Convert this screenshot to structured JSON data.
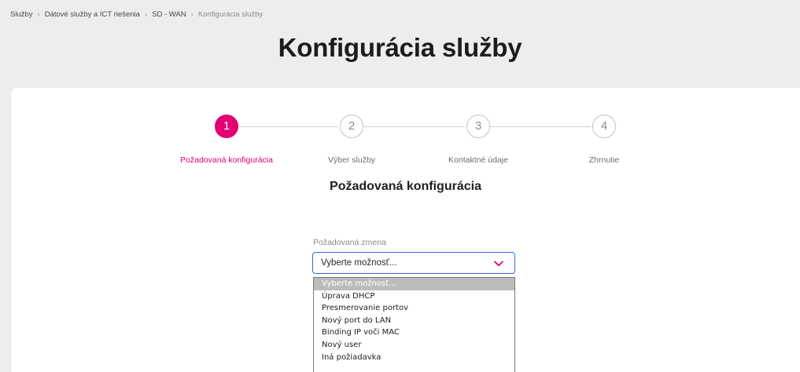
{
  "breadcrumb": {
    "items": [
      "Služby",
      "Dátové služby a ICT riešenia",
      "SD - WAN",
      "Konfigurácia služby"
    ],
    "separator": "›"
  },
  "page": {
    "title": "Konfigurácia služby"
  },
  "stepper": {
    "active_color": "#e20074",
    "steps": [
      {
        "number": "1",
        "label": "Požadovaná konfigurácia",
        "active": true
      },
      {
        "number": "2",
        "label": "Výber služby",
        "active": false
      },
      {
        "number": "3",
        "label": "Kontaktné údaje",
        "active": false
      },
      {
        "number": "4",
        "label": "Zhrnutie",
        "active": false
      }
    ]
  },
  "form": {
    "section_title": "Požadovaná konfigurácia",
    "field_label": "Požadovaná zmena",
    "select": {
      "value": "Vyberte možnosť...",
      "icon": "chevron-down-icon",
      "options": [
        "Vyberte možnosť...",
        "Úprava DHCP",
        "Presmerovanie portov",
        "Nový port do LAN",
        "Binding IP voči MAC",
        "Nový user",
        "Iná požiadavka"
      ],
      "highlighted_index": 0
    }
  }
}
